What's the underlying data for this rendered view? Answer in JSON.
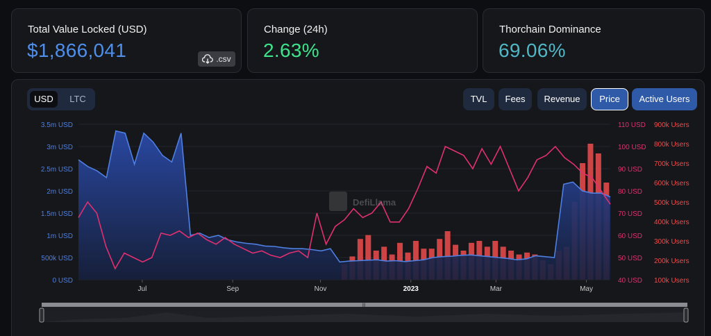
{
  "stats": [
    {
      "label": "Total Value Locked (USD)",
      "value": "$1,866,041",
      "color": "#4f8fea"
    },
    {
      "label": "Change (24h)",
      "value": "2.63%",
      "color": "#3ee38b"
    },
    {
      "label": "Thorchain Dominance",
      "value": "69.06%",
      "color": "#4fb7c6"
    }
  ],
  "csv_label": ".csv",
  "toggle": {
    "usd": "USD",
    "ltc": "LTC"
  },
  "metrics": {
    "tvl": "TVL",
    "fees": "Fees",
    "revenue": "Revenue",
    "price": "Price",
    "active_users": "Active Users"
  },
  "watermark": "DefiLlama",
  "colors": {
    "tvl": "#4f7fe0",
    "price": "#e0306e",
    "users": "#ef4b4b"
  },
  "chart_data": {
    "type": "line",
    "x_ticks": [
      "Jul",
      "Sep",
      "Nov",
      "2023",
      "Mar",
      "May"
    ],
    "y_left": {
      "unit": "USD",
      "ticks": [
        "0 USD",
        "500k USD",
        "1m USD",
        "1.5m USD",
        "2m USD",
        "2.5m USD",
        "3m USD",
        "3.5m USD"
      ],
      "range": [
        0,
        3500000
      ]
    },
    "y_right_price": {
      "unit": "USD",
      "ticks": [
        "40 USD",
        "50 USD",
        "60 USD",
        "70 USD",
        "80 USD",
        "90 USD",
        "100 USD",
        "110 USD"
      ],
      "range": [
        40,
        110
      ]
    },
    "y_right_users": {
      "unit": "Users",
      "ticks": [
        "100k Users",
        "200k Users",
        "300k Users",
        "400k Users",
        "500k Users",
        "600k Users",
        "700k Users",
        "800k Users",
        "900k Users"
      ],
      "range": [
        100000,
        900000
      ]
    },
    "series": [
      {
        "name": "TVL",
        "type": "area",
        "axis": "left",
        "values": [
          2700000,
          2550000,
          2450000,
          2300000,
          3350000,
          3300000,
          2600000,
          3300000,
          3100000,
          2800000,
          2650000,
          3300000,
          1000000,
          1050000,
          950000,
          1000000,
          900000,
          850000,
          820000,
          800000,
          760000,
          750000,
          720000,
          700000,
          700000,
          680000,
          650000,
          700000,
          400000,
          420000,
          430000,
          440000,
          450000,
          420000,
          430000,
          410000,
          430000,
          450000,
          500000,
          520000,
          530000,
          550000,
          560000,
          540000,
          520000,
          500000,
          480000,
          450000,
          470000,
          540000,
          520000,
          500000,
          2150000,
          2200000,
          2000000,
          1950000,
          1950000,
          1866041
        ]
      },
      {
        "name": "Price",
        "type": "line",
        "axis": "right_price",
        "values": [
          68,
          75,
          70,
          55,
          45,
          52,
          50,
          48,
          50,
          61,
          60,
          62,
          59,
          61,
          58,
          56,
          59,
          56,
          54,
          52,
          53,
          51,
          50,
          52,
          53,
          50,
          70,
          56,
          64,
          67,
          72,
          68,
          70,
          75,
          66,
          66,
          72,
          81,
          91,
          88,
          100,
          98,
          96,
          90,
          99,
          92,
          100,
          90,
          80,
          86,
          94,
          96,
          100,
          95,
          92,
          88,
          86,
          80,
          74
        ]
      },
      {
        "name": "Active Users",
        "type": "bar",
        "axis": "right_users",
        "values": [
          0,
          0,
          0,
          0,
          0,
          0,
          0,
          0,
          0,
          0,
          0,
          0,
          0,
          0,
          0,
          0,
          0,
          0,
          0,
          0,
          0,
          0,
          0,
          0,
          0,
          0,
          0,
          0,
          0,
          0,
          0,
          0,
          0,
          180000,
          220000,
          310000,
          330000,
          250000,
          270000,
          230000,
          290000,
          240000,
          300000,
          260000,
          260000,
          310000,
          350000,
          280000,
          250000,
          290000,
          300000,
          270000,
          300000,
          270000,
          250000,
          230000,
          240000,
          230000,
          200000,
          180000,
          250000,
          270000,
          500000,
          700000,
          800000,
          750000,
          600000
        ]
      }
    ]
  }
}
